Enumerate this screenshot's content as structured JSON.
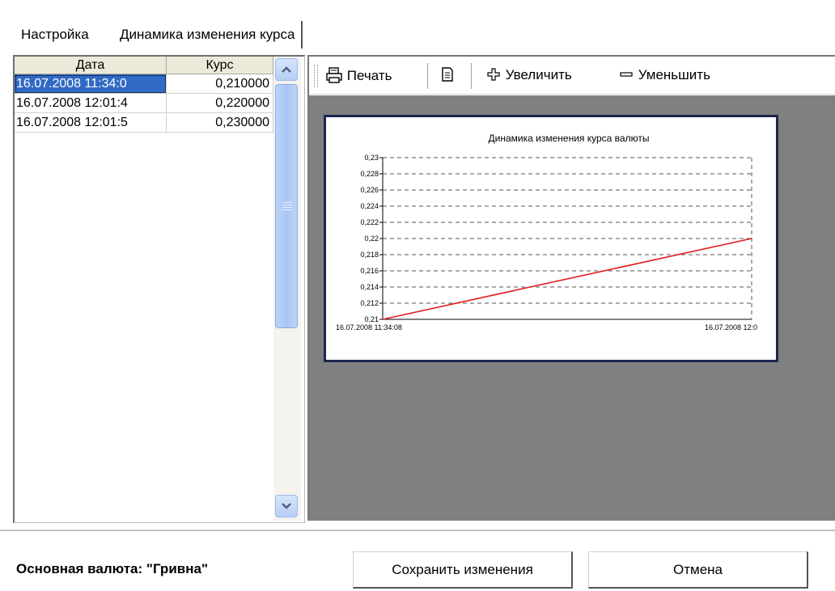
{
  "tabs": [
    {
      "label": "Настройка"
    },
    {
      "label": "Динамика изменения курса"
    }
  ],
  "grid": {
    "columns": [
      "Дата",
      "Курс"
    ],
    "rows": [
      {
        "date": "16.07.2008 11:34:0",
        "rate": "0,210000"
      },
      {
        "date": "16.07.2008 12:01:4",
        "rate": "0,220000"
      },
      {
        "date": "16.07.2008 12:01:5",
        "rate": "0,230000"
      }
    ]
  },
  "toolbar": {
    "print_label": "Печать",
    "zoom_in_label": "Увеличить",
    "zoom_out_label": "Уменьшить"
  },
  "chart_data": {
    "type": "line",
    "title": "Динамика изменения курса валюты",
    "x_tick_labels": [
      "16.07.2008 11:34:08",
      "16.07.2008 12:0"
    ],
    "y_ticks": [
      "0,21",
      "0,212",
      "0,214",
      "0,216",
      "0,218",
      "0,22",
      "0,222",
      "0,224",
      "0,226",
      "0,228",
      "0,23"
    ],
    "ylim": [
      0.21,
      0.23
    ],
    "grid": true,
    "series": [
      {
        "color": "#e02020",
        "x": [
          "16.07.2008 11:34:08",
          "16.07.2008 12:0"
        ],
        "values": [
          0.21,
          0.22
        ]
      }
    ]
  },
  "footer": {
    "currency_label": "Основная валюта: \"Гривна\"",
    "save_label": "Сохранить изменения",
    "cancel_label": "Отмена"
  },
  "colors": {
    "selection": "#316ac5",
    "canvas": "#808080",
    "page_border": "#1d2650",
    "line": "#e02020"
  }
}
